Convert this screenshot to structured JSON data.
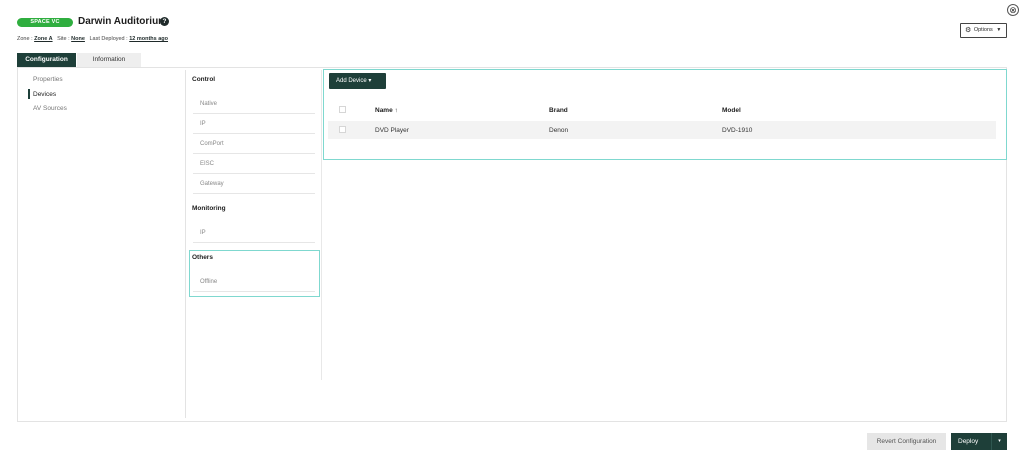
{
  "header": {
    "badge": "SPACE VC",
    "title": "Darwin Auditorium",
    "help_icon": "?",
    "close_icon": "⊗",
    "options_label": "Options",
    "options_icon": "gear-icon"
  },
  "meta": {
    "zone_label": "Zone :",
    "zone_value": "Zone A",
    "site_label": "Site :",
    "site_value": "None",
    "deployed_label": "Last Deployed :",
    "deployed_value": "12 months ago"
  },
  "tabs": {
    "configuration": "Configuration",
    "information": "Information"
  },
  "left_nav": {
    "properties": "Properties",
    "devices": "Devices",
    "av_sources": "AV Sources"
  },
  "protocols": {
    "control_heading": "Control",
    "control_items": [
      "Native",
      "IP",
      "ComPort",
      "EISC",
      "Gateway"
    ],
    "monitoring_heading": "Monitoring",
    "monitoring_items": [
      "IP"
    ],
    "others_heading": "Others",
    "others_items": [
      "Offline"
    ]
  },
  "devices": {
    "add_button": "Add Device",
    "add_button_caret": "▾",
    "columns": {
      "name": "Name",
      "sort_indicator": "↑",
      "brand": "Brand",
      "model": "Model"
    },
    "rows": [
      {
        "name": "DVD Player",
        "brand": "Denon",
        "model": "DVD-1910"
      }
    ]
  },
  "footer": {
    "revert": "Revert Configuration",
    "deploy": "Deploy",
    "deploy_caret": "▾"
  },
  "colors": {
    "accent_dark": "#1e3f39",
    "badge_green": "#2fae3f",
    "highlight": "#7fd8cf"
  }
}
